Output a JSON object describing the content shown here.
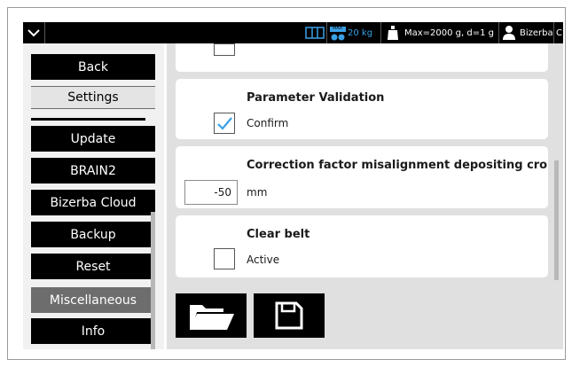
{
  "topbar": {
    "scale_max_badge": "MAX",
    "scale_capacity": "20 kg",
    "range_info": "Max=2000 g, d=1 g",
    "user_name": "Bizerba",
    "overflow_char": "C"
  },
  "sidebar": {
    "back": "Back",
    "settings": "Settings",
    "items": [
      "Update",
      "BRAIN2",
      "Bizerba Cloud",
      "Backup",
      "Reset",
      "Miscellaneous",
      "Info"
    ],
    "active_item": "Miscellaneous"
  },
  "cards": {
    "param_validation": {
      "title": "Parameter Validation",
      "label": "Confirm",
      "checked": true
    },
    "correction": {
      "title": "Correction factor misalignment depositing cro",
      "value": "-50",
      "unit": "mm"
    },
    "clear_belt": {
      "title": "Clear belt",
      "label": "Active",
      "checked": false
    }
  },
  "toolbar": {
    "open_icon": "folder-open-icon",
    "save_icon": "save-icon"
  },
  "colors": {
    "accent": "#3aa0e6",
    "active_nav": "#6d6d6d",
    "nav_bg": "#000000"
  }
}
